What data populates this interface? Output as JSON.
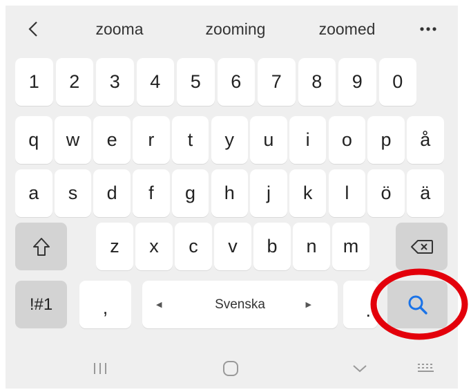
{
  "suggestions": {
    "back_icon": "chevron-left-icon",
    "words": [
      "zooma",
      "zooming",
      "zoomed"
    ],
    "more_icon": "more-icon"
  },
  "rows": [
    [
      "1",
      "2",
      "3",
      "4",
      "5",
      "6",
      "7",
      "8",
      "9",
      "0"
    ],
    [
      "q",
      "w",
      "e",
      "r",
      "t",
      "y",
      "u",
      "i",
      "o",
      "p",
      "å"
    ],
    [
      "a",
      "s",
      "d",
      "f",
      "g",
      "h",
      "j",
      "k",
      "l",
      "ö",
      "ä"
    ],
    [
      "z",
      "x",
      "c",
      "v",
      "b",
      "n",
      "m"
    ]
  ],
  "bottom": {
    "symbols": "!#1",
    "comma": ",",
    "space": "Svenska",
    "period": "."
  },
  "icons": {
    "shift": "shift-icon",
    "backspace": "backspace-icon",
    "search": "search-icon",
    "recents": "recent-apps-icon",
    "home": "home-icon",
    "hide": "hide-keyboard-icon",
    "keyboard": "keyboard-icon"
  },
  "colors": {
    "accent": "#1a73e8",
    "annotation": "#e3000b"
  }
}
